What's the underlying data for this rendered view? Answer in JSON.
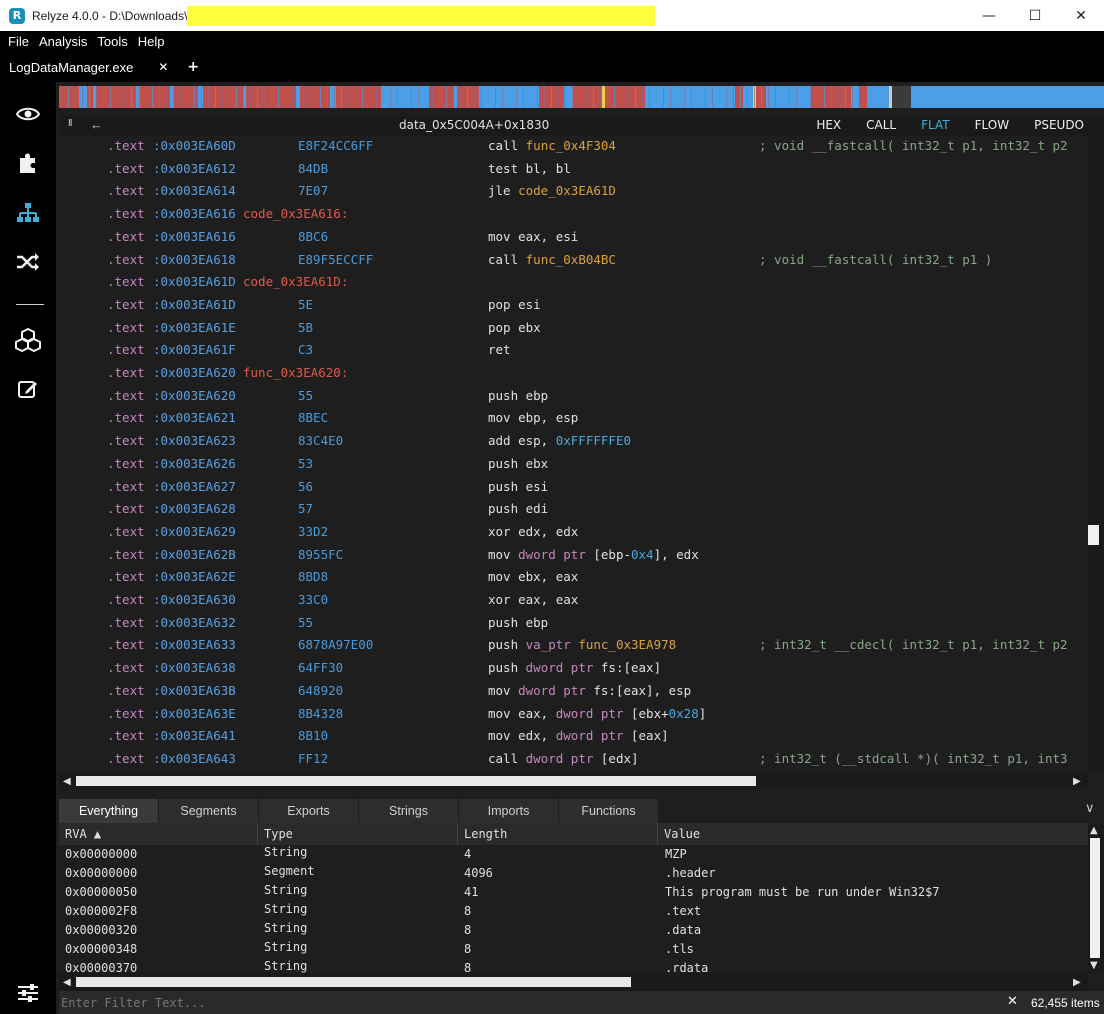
{
  "window": {
    "title": "Relyze 4.0.0 - D:\\Downloads\\",
    "minimize_glyph": "—",
    "maximize_glyph": "☐",
    "close_glyph": "✕"
  },
  "menu": [
    "File",
    "Analysis",
    "Tools",
    "Help"
  ],
  "document_tab": {
    "label": "LogDataManager.exe",
    "close_glyph": "✕",
    "add_glyph": "+"
  },
  "sidebar_icons": [
    "eye-icon",
    "puzzle-icon",
    "hierarchy-icon",
    "shuffle-icon",
    "cubes-icon",
    "edit-icon",
    "sliders-icon"
  ],
  "disassembly": {
    "location": "data_0x5C004A+0x1830",
    "pause_glyph": "II",
    "back_glyph": "←",
    "view_tabs": [
      {
        "label": "HEX",
        "active": false
      },
      {
        "label": "CALL",
        "active": false
      },
      {
        "label": "FLAT",
        "active": true
      },
      {
        "label": "FLOW",
        "active": false
      },
      {
        "label": "PSEUDO",
        "active": false
      }
    ],
    "rows": [
      {
        "seg": ".text",
        "addr": ":0x003EA60D",
        "bytes": "E8F24CC6FF",
        "ins": "call ",
        "op_func": "func_0x4F304",
        "cmt": "; void __fastcall( int32_t p1, int32_t p2"
      },
      {
        "seg": ".text",
        "addr": ":0x003EA612",
        "bytes": "84DB",
        "ins": "test bl, bl"
      },
      {
        "seg": ".text",
        "addr": ":0x003EA614",
        "bytes": "7E07",
        "ins": "jle ",
        "op_func": "code_0x3EA61D"
      },
      {
        "seg": ".text",
        "addr": ":0x003EA616",
        "label": "code_0x3EA616:"
      },
      {
        "seg": ".text",
        "addr": ":0x003EA616",
        "bytes": "8BC6",
        "ins": "mov eax, esi"
      },
      {
        "seg": ".text",
        "addr": ":0x003EA618",
        "bytes": "E89F5ECCFF",
        "ins": "call ",
        "op_func": "func_0xB04BC",
        "cmt": "; void __fastcall( int32_t p1 )"
      },
      {
        "seg": ".text",
        "addr": ":0x003EA61D",
        "label": "code_0x3EA61D:"
      },
      {
        "seg": ".text",
        "addr": ":0x003EA61D",
        "bytes": "5E",
        "ins": "pop esi"
      },
      {
        "seg": ".text",
        "addr": ":0x003EA61E",
        "bytes": "5B",
        "ins": "pop ebx"
      },
      {
        "seg": ".text",
        "addr": ":0x003EA61F",
        "bytes": "C3",
        "ins": "ret"
      },
      {
        "seg": ".text",
        "addr": ":0x003EA620",
        "label": "func_0x3EA620:"
      },
      {
        "seg": ".text",
        "addr": ":0x003EA620",
        "bytes": "55",
        "ins": "push ebp"
      },
      {
        "seg": ".text",
        "addr": ":0x003EA621",
        "bytes": "8BEC",
        "ins": "mov ebp, esp"
      },
      {
        "seg": ".text",
        "addr": ":0x003EA623",
        "bytes": "83C4E0",
        "ins": "add esp, ",
        "op_num": "0xFFFFFFE0"
      },
      {
        "seg": ".text",
        "addr": ":0x003EA626",
        "bytes": "53",
        "ins": "push ebx"
      },
      {
        "seg": ".text",
        "addr": ":0x003EA627",
        "bytes": "56",
        "ins": "push esi"
      },
      {
        "seg": ".text",
        "addr": ":0x003EA628",
        "bytes": "57",
        "ins": "push edi"
      },
      {
        "seg": ".text",
        "addr": ":0x003EA629",
        "bytes": "33D2",
        "ins": "xor edx, edx"
      },
      {
        "seg": ".text",
        "addr": ":0x003EA62B",
        "bytes": "8955FC",
        "ins": "mov ",
        "op_kw": "dword ptr",
        "op_rest": " [ebp-",
        "op_num": "0x4",
        "op_tail": "], edx"
      },
      {
        "seg": ".text",
        "addr": ":0x003EA62E",
        "bytes": "8BD8",
        "ins": "mov ebx, eax"
      },
      {
        "seg": ".text",
        "addr": ":0x003EA630",
        "bytes": "33C0",
        "ins": "xor eax, eax"
      },
      {
        "seg": ".text",
        "addr": ":0x003EA632",
        "bytes": "55",
        "ins": "push ebp"
      },
      {
        "seg": ".text",
        "addr": ":0x003EA633",
        "bytes": "6878A97E00",
        "ins": "push ",
        "op_kw": "va_ptr",
        "op_func2": " func_0x3EA978",
        "cmt": "; int32_t __cdecl( int32_t p1, int32_t p2"
      },
      {
        "seg": ".text",
        "addr": ":0x003EA638",
        "bytes": "64FF30",
        "ins": "push ",
        "op_kw": "dword ptr",
        "op_tail": " fs:[eax]"
      },
      {
        "seg": ".text",
        "addr": ":0x003EA63B",
        "bytes": "648920",
        "ins": "mov ",
        "op_kw": "dword ptr",
        "op_tail": " fs:[eax], esp"
      },
      {
        "seg": ".text",
        "addr": ":0x003EA63E",
        "bytes": "8B4328",
        "ins": "mov eax, ",
        "op_kw": "dword ptr",
        "op_rest": " [ebx+",
        "op_num": "0x28",
        "op_tail": "]"
      },
      {
        "seg": ".text",
        "addr": ":0x003EA641",
        "bytes": "8B10",
        "ins": "mov edx, ",
        "op_kw": "dword ptr",
        "op_tail": " [eax]"
      },
      {
        "seg": ".text",
        "addr": ":0x003EA643",
        "bytes": "FF12",
        "ins": "call ",
        "op_kw": "dword ptr",
        "op_tail": " [edx]",
        "cmt": "; int32_t (__stdcall *)( int32_t p1, int3"
      }
    ]
  },
  "bottom_panel": {
    "tabs": [
      {
        "label": "Everything",
        "active": true
      },
      {
        "label": "Segments",
        "active": false
      },
      {
        "label": "Exports",
        "active": false
      },
      {
        "label": "Strings",
        "active": false
      },
      {
        "label": "Imports",
        "active": false
      },
      {
        "label": "Functions",
        "active": false
      }
    ],
    "collapse_glyph": "∨",
    "columns": [
      "RVA ▲",
      "Type",
      "Length",
      "Value"
    ],
    "rows": [
      [
        "0x00000000",
        "String",
        "4",
        "MZP"
      ],
      [
        "0x00000000",
        "Segment",
        "4096",
        ".header"
      ],
      [
        "0x00000050",
        "String",
        "41",
        "This program must be run under Win32$7"
      ],
      [
        "0x000002F8",
        "String",
        "8",
        ".text"
      ],
      [
        "0x00000320",
        "String",
        "8",
        ".data"
      ],
      [
        "0x00000348",
        "String",
        "8",
        ".tls"
      ],
      [
        "0x00000370",
        "String",
        "8",
        ".rdata"
      ]
    ],
    "filter_placeholder": "Enter Filter Text...",
    "clear_glyph": "✕",
    "item_count": "62,455 items"
  },
  "colors": {
    "overview_red": "#c0504d",
    "overview_blue": "#4a9fe8",
    "accent_active": "#3cb0d8"
  }
}
